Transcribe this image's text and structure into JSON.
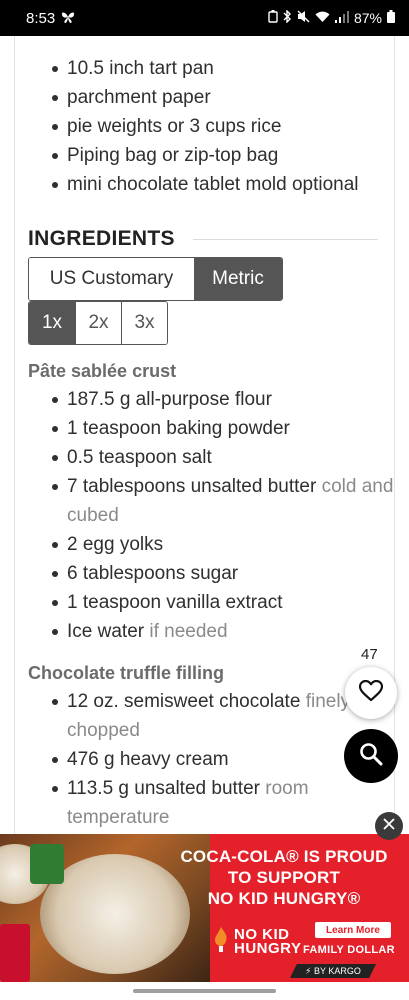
{
  "status_bar": {
    "time": "8:53",
    "battery": "87%"
  },
  "equipment": [
    "10.5 inch tart pan",
    "parchment paper",
    "pie weights or 3 cups rice",
    "Piping bag or zip-top bag",
    "mini chocolate tablet mold optional"
  ],
  "ingredients": {
    "title": "INGREDIENTS",
    "units": {
      "us": "US Customary",
      "metric": "Metric",
      "selected": "Metric"
    },
    "scales": [
      "1x",
      "2x",
      "3x"
    ],
    "groups": [
      {
        "title": "Pâte sablée crust",
        "items": [
          {
            "text": "187.5 g all-purpose flour",
            "note": ""
          },
          {
            "text": "1 teaspoon baking powder",
            "note": ""
          },
          {
            "text": "0.5 teaspoon salt",
            "note": ""
          },
          {
            "text": "7 tablespoons unsalted butter",
            "note": "cold and cubed"
          },
          {
            "text": "2 egg yolks",
            "note": ""
          },
          {
            "text": "6 tablespoons sugar",
            "note": ""
          },
          {
            "text": "1 teaspoon vanilla extract",
            "note": ""
          },
          {
            "text": "Ice water",
            "note": "if needed"
          }
        ]
      },
      {
        "title": "Chocolate truffle filling",
        "items": [
          {
            "text": "12 oz. semisweet chocolate",
            "note": "finely chopped"
          },
          {
            "text": "476 g heavy cream",
            "note": ""
          },
          {
            "text": "113.5 g unsalted butter",
            "note": "room temperature"
          }
        ]
      }
    ]
  },
  "floating": {
    "favorite_count": "47"
  },
  "ad": {
    "headline_1": "COCA-COLA® IS PROUD",
    "headline_2": "TO SUPPORT",
    "headline_3": "NO KID HUNGRY®",
    "nkh_1": "NO KID",
    "nkh_2": "HUNGRY",
    "learn_more": "Learn More",
    "family_dollar": "FAMILY DOLLAR",
    "kargo": "⚡ BY KARGO"
  },
  "colors": {
    "ad_red": "#e4212a",
    "toggle_active": "#555555"
  }
}
